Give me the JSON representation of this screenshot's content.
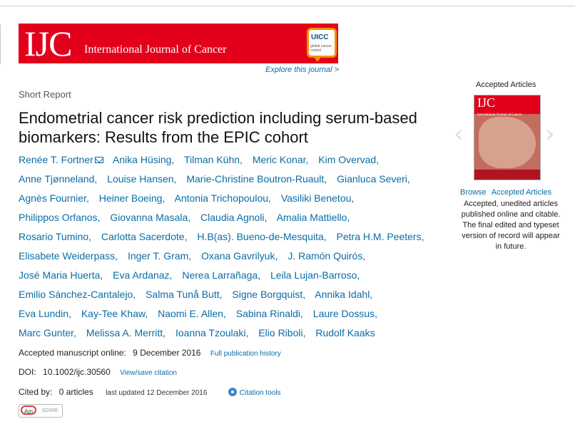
{
  "header": {
    "logo_abbrev": "IJC",
    "journal_name": "International Journal of Cancer",
    "partner_logo": "UICC",
    "partner_sub": "global cancer control",
    "explore_link": "Explore this journal >"
  },
  "article": {
    "type": "Short Report",
    "title": "Endometrial cancer risk prediction including serum-based biomarkers: Results from the EPIC cohort",
    "authors": [
      "Renée T. Fortner",
      "Anika Hüsing,",
      "Tilman Kühn,",
      "Meric Konar,",
      "Kim Overvad,",
      "Anne Tjønneland,",
      "Louise Hansen,",
      "Marie-Christine Boutron-Ruault,",
      "Gianluca Severi,",
      "Agnès Fournier,",
      "Heiner Boeing,",
      "Antonia Trichopoulou,",
      "Vasiliki Benetou,",
      "Philippos Orfanos,",
      "Giovanna Masala,",
      "Claudia Agnoli,",
      "Amalia Mattiello,",
      "Rosario Tumino,",
      "Carlotta Sacerdote,",
      "H.B(as). Bueno-de-Mesquita,",
      "Petra H.M. Peeters,",
      "Elisabete Weiderpass,",
      "Inger T. Gram,",
      "Oxana Gavrilyuk,",
      "J. Ramón Quirós,",
      "José Maria Huerta,",
      "Eva Ardanaz,",
      "Nerea Larrañaga,",
      "Leila Lujan-Barroso,",
      "Emilio Sánchez-Cantalejo,",
      "Salma Tunå Butt,",
      "Signe Borgquist,",
      "Annika Idahl,",
      "Eva Lundin,",
      "Kay-Tee Khaw,",
      "Naomi E. Allen,",
      "Sabina Rinaldi,",
      "Laure Dossus,",
      "Marc Gunter,",
      "Melissa A. Merritt,",
      "Ioanna Tzoulaki,",
      "Elio Riboli,",
      "Rudolf Kaaks"
    ],
    "accepted_label": "Accepted manuscript online:",
    "accepted_date": "9 December 2016",
    "history_link": "Full publication history",
    "doi_label": "DOI:",
    "doi": "10.1002/ijc.30560",
    "view_citation": "View/save citation",
    "cited_label": "Cited by:",
    "cited_value": "0 articles",
    "last_updated": "last updated 12 December 2016",
    "citation_tools": "Citation tools",
    "altmetric_am": "Am",
    "altmetric_score": "score"
  },
  "sidebar": {
    "title": "Accepted Articles",
    "cover_logo": "IJC",
    "cover_sub": "International Journal of Cancer",
    "browse": "Browse",
    "accepted_link": "Accepted Articles",
    "description": "Accepted, unedited articles published online and citable. The final edited and typeset version of record will appear in future."
  }
}
